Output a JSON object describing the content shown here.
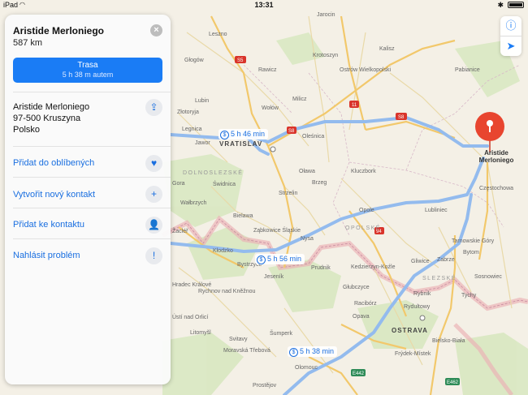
{
  "status_bar": {
    "device": "iPad",
    "time": "13:31"
  },
  "place": {
    "name": "Aristide Merloniego",
    "distance": "587 km",
    "address_lines": [
      "Aristide Merloniego",
      "97-500 Kruszyna",
      "Polsko"
    ]
  },
  "route_button": {
    "label": "Trasa",
    "sublabel": "5 h 38 m autem"
  },
  "actions": {
    "favorite": "Přidat do oblíbených",
    "new_contact": "Vytvořit nový kontakt",
    "add_to_contact": "Přidat ke kontaktu",
    "report": "Nahlásit problém"
  },
  "map": {
    "route_labels": [
      "5 h 46 min",
      "5 h 56 min",
      "5 h 38 min"
    ],
    "pin_label": [
      "Aristide",
      "Merloniego"
    ],
    "cities": [
      "VRATISLAV",
      "OSTRAVA"
    ],
    "regions": [
      "DOLNOSLEZSKÉ",
      "OPOLSKÉ",
      "SLEZSKÉ"
    ],
    "towns": [
      "Jarocin",
      "Leszno",
      "Krotoszyn",
      "Kalisz",
      "Głogów",
      "Rawicz",
      "Ostrów Wielkopolski",
      "Pabianice",
      "Lubin",
      "Milicz",
      "Legnica",
      "Oleśnica",
      "Złotoryja",
      "Jawor",
      "Oława",
      "Kluczbork",
      "Częstochowa",
      "Świdnica",
      "Strzelin",
      "Brzeg",
      "Wałbrzych",
      "Opole",
      "Lubliniec",
      "Bielawa",
      "Ząbkowice Śląskie",
      "Kłodzko",
      "Nysa",
      "Tarnowskie Góry",
      "Kedzierzyn-Koźle",
      "Bytom",
      "Zabrze",
      "Gliwice",
      "Sosnowiec",
      "Prudnik",
      "Bystrzyce",
      "Jeseník",
      "Hradec Králové",
      "Rychnov nad Kněžnou",
      "Głubczyce",
      "Rybnik",
      "Tychy",
      "Racibórz",
      "Rydultowy",
      "Opava",
      "Bielsko-Biała",
      "Frýdek-Místek",
      "Prostějov",
      "Olomouc",
      "Šumperk",
      "Ústí nad Orlicí",
      "Svitavy",
      "Moravská Třebová",
      "Litomyšl",
      "Žacléř",
      "Gora",
      "Wołów"
    ],
    "road_shields": [
      "S5",
      "S8",
      "S8",
      "11",
      "S8",
      "94",
      "E442",
      "E462",
      "11"
    ]
  },
  "colors": {
    "accent": "#1a7cf5",
    "route": "#8fb8ef",
    "pin": "#e8452f",
    "land": "#f4f0e6",
    "forest": "#cfe3b5",
    "border": "#e8a2a6"
  },
  "icons": {
    "close": "close-icon",
    "share": "share-icon",
    "favorite": "heart-icon",
    "new_contact": "plus-icon",
    "add_contact": "add-person-icon",
    "report": "speech-bubble-icon",
    "info": "info-icon",
    "location": "location-arrow-icon"
  }
}
